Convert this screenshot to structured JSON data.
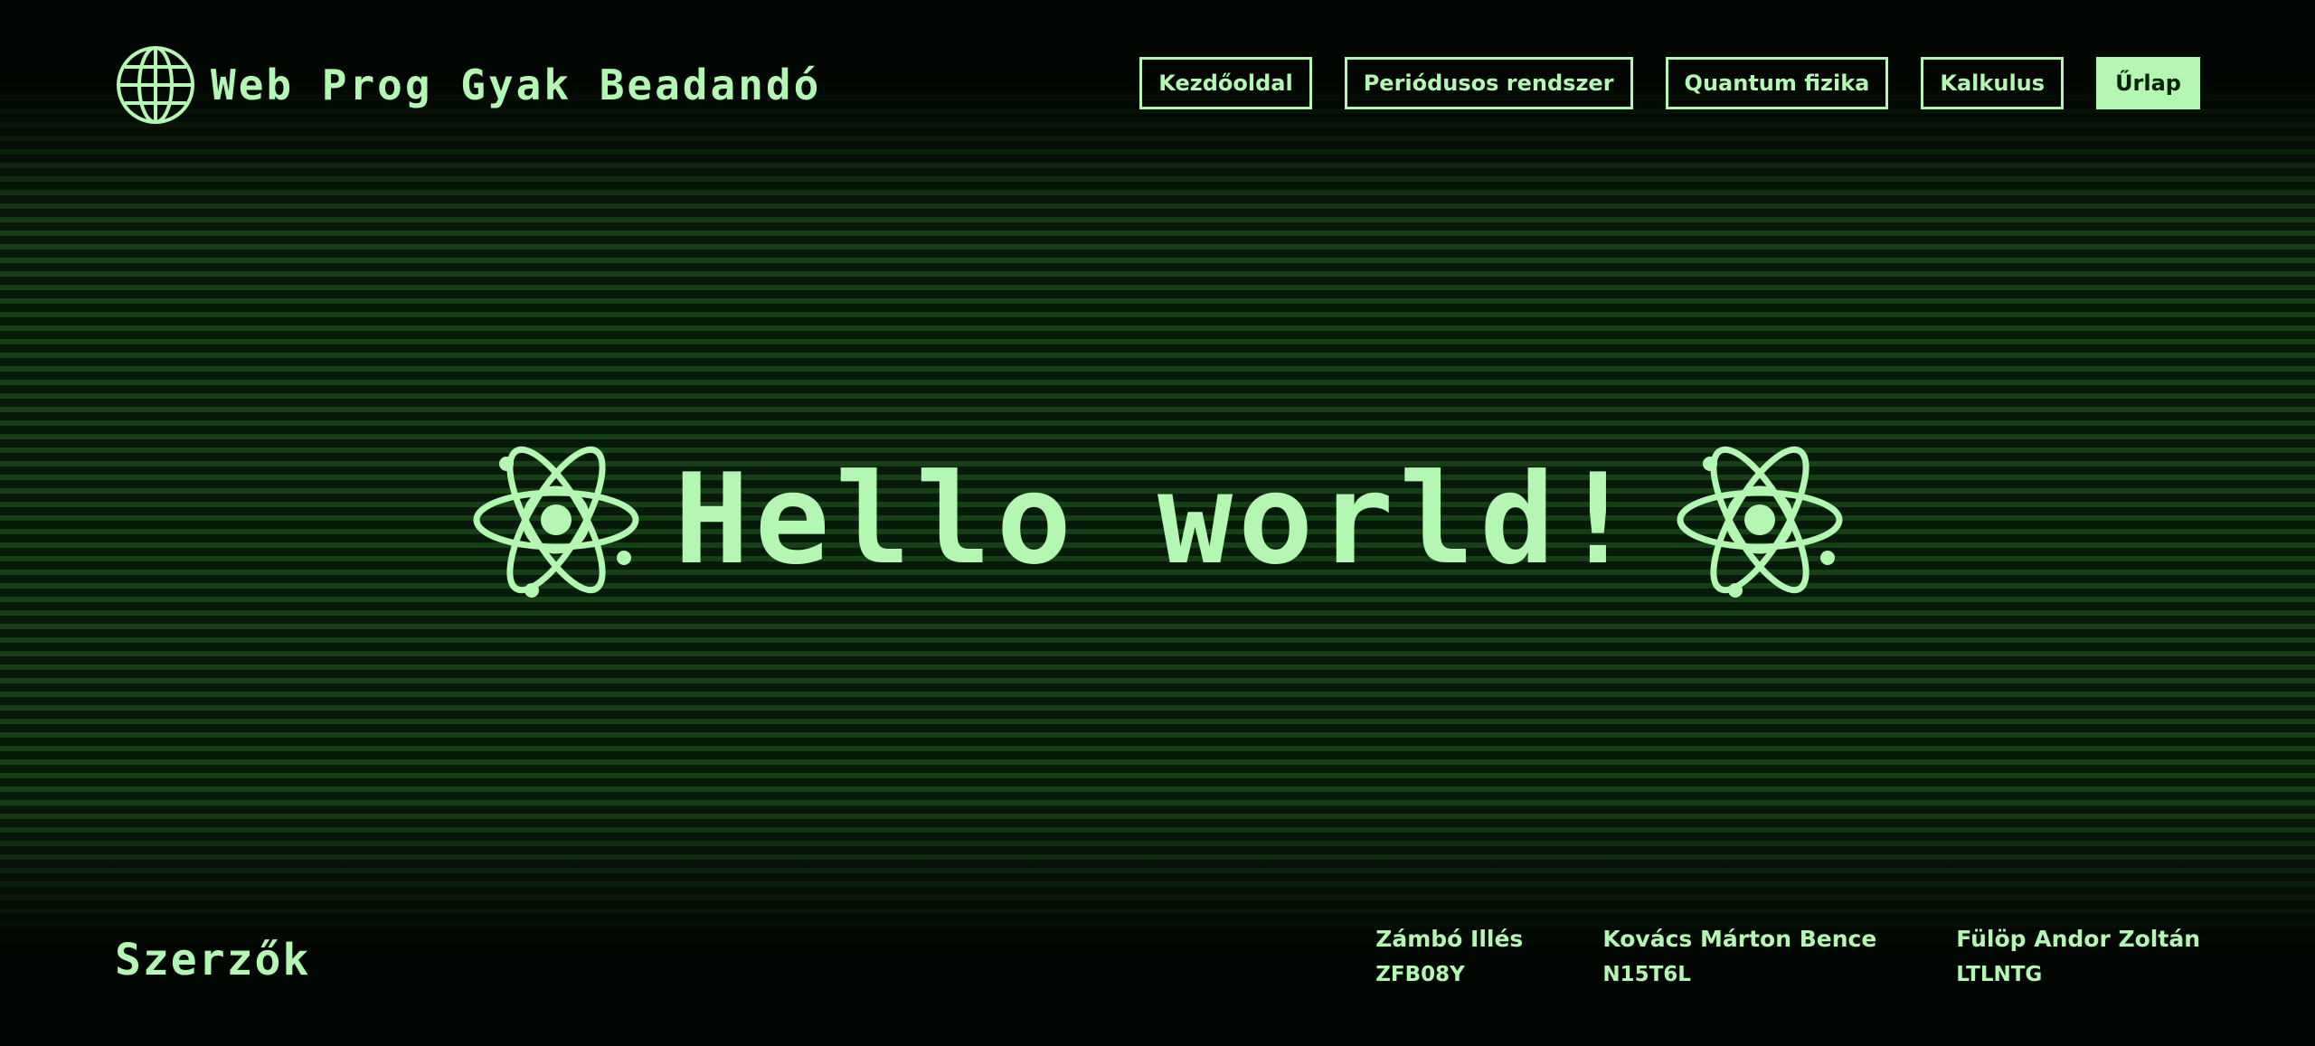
{
  "header": {
    "title": "Web Prog Gyak Beadandó",
    "logo_icon": "globe-icon",
    "nav": [
      {
        "label": "Kezdőoldal",
        "active": false
      },
      {
        "label": "Periódusos rendszer",
        "active": false
      },
      {
        "label": "Quantum fizika",
        "active": false
      },
      {
        "label": "Kalkulus",
        "active": false
      },
      {
        "label": "Űrlap",
        "active": true
      }
    ]
  },
  "hero": {
    "title": "Hello world!",
    "icon": "atom-icon"
  },
  "footer": {
    "title": "Szerzők",
    "authors": [
      {
        "name": "Zámbó Illés",
        "code": "ZFB08Y"
      },
      {
        "name": "Kovács Márton Bence",
        "code": "N15T6L"
      },
      {
        "name": "Fülöp Andor Zoltán",
        "code": "LTLNTG"
      }
    ]
  },
  "colors": {
    "accent": "#b3f7b3",
    "background": "#020602",
    "scanline": "#286e28"
  }
}
